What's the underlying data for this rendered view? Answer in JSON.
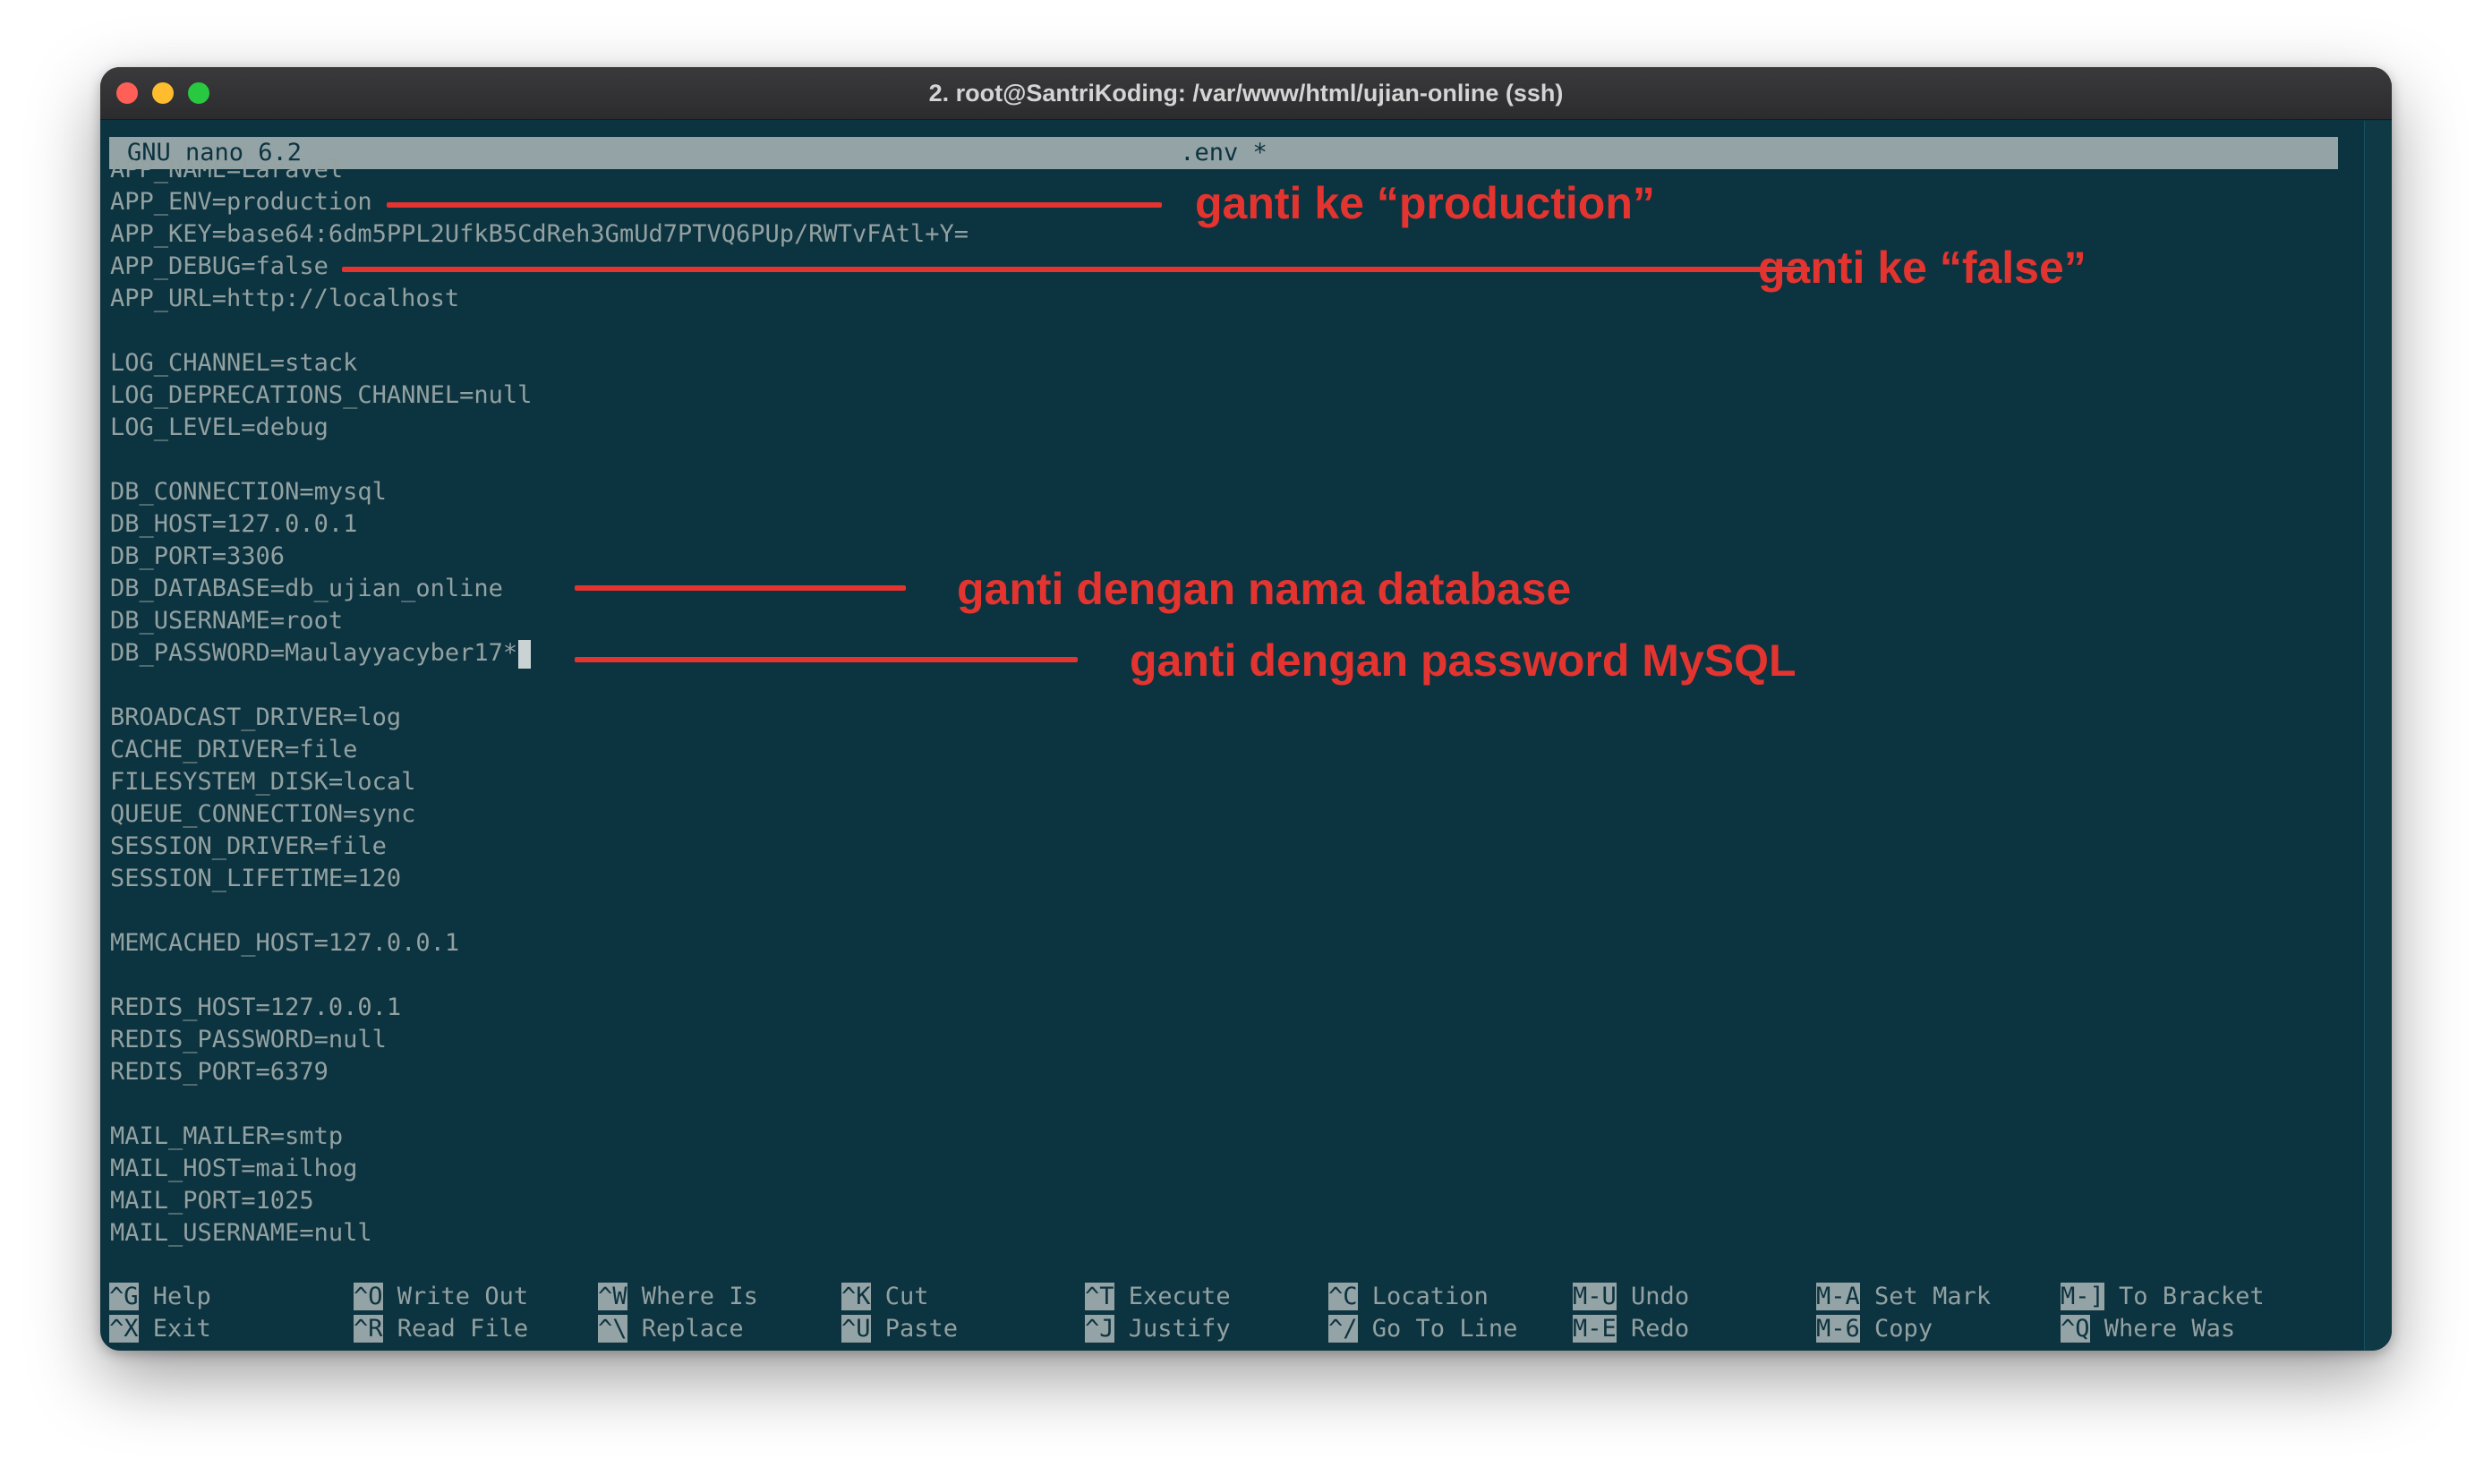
{
  "window": {
    "title": "2. root@SantriKoding: /var/www/html/ujian-online (ssh)"
  },
  "nano": {
    "version": "GNU nano 6.2",
    "filename": ".env *"
  },
  "file_lines": [
    "APP_NAME=Laravel",
    "APP_ENV=production",
    "APP_KEY=base64:6dm5PPL2UfkB5CdReh3GmUd7PTVQ6PUp/RWTvFAtl+Y=",
    "APP_DEBUG=false",
    "APP_URL=http://localhost",
    "",
    "LOG_CHANNEL=stack",
    "LOG_DEPRECATIONS_CHANNEL=null",
    "LOG_LEVEL=debug",
    "",
    "DB_CONNECTION=mysql",
    "DB_HOST=127.0.0.1",
    "DB_PORT=3306",
    "DB_DATABASE=db_ujian_online",
    "DB_USERNAME=root",
    "DB_PASSWORD=Maulayyacyber17*",
    "",
    "BROADCAST_DRIVER=log",
    "CACHE_DRIVER=file",
    "FILESYSTEM_DISK=local",
    "QUEUE_CONNECTION=sync",
    "SESSION_DRIVER=file",
    "SESSION_LIFETIME=120",
    "",
    "MEMCACHED_HOST=127.0.0.1",
    "",
    "REDIS_HOST=127.0.0.1",
    "REDIS_PASSWORD=null",
    "REDIS_PORT=6379",
    "",
    "MAIL_MAILER=smtp",
    "MAIL_HOST=mailhog",
    "MAIL_PORT=1025",
    "MAIL_USERNAME=null"
  ],
  "annotations": [
    {
      "text": "ganti ke “production”"
    },
    {
      "text": "ganti ke “false”"
    },
    {
      "text": "ganti dengan nama database"
    },
    {
      "text": "ganti dengan password MySQL"
    }
  ],
  "shortcuts": [
    {
      "key": "^G",
      "label": "Help"
    },
    {
      "key": "^O",
      "label": "Write Out"
    },
    {
      "key": "^W",
      "label": "Where Is"
    },
    {
      "key": "^K",
      "label": "Cut"
    },
    {
      "key": "^T",
      "label": "Execute"
    },
    {
      "key": "^C",
      "label": "Location"
    },
    {
      "key": "M-U",
      "label": "Undo"
    },
    {
      "key": "M-A",
      "label": "Set Mark"
    },
    {
      "key": "M-]",
      "label": "To Bracket"
    },
    {
      "key": "^X",
      "label": "Exit"
    },
    {
      "key": "^R",
      "label": "Read File"
    },
    {
      "key": "^\\",
      "label": "Replace"
    },
    {
      "key": "^U",
      "label": "Paste"
    },
    {
      "key": "^J",
      "label": "Justify"
    },
    {
      "key": "^/",
      "label": "Go To Line"
    },
    {
      "key": "M-E",
      "label": "Redo"
    },
    {
      "key": "M-6",
      "label": "Copy"
    },
    {
      "key": "^Q",
      "label": "Where Was"
    }
  ],
  "colors": {
    "terminal_bg": "#0c3340",
    "text": "#93a1a1",
    "annotation": "#e3342f",
    "header_bar": "#94a3a5"
  }
}
